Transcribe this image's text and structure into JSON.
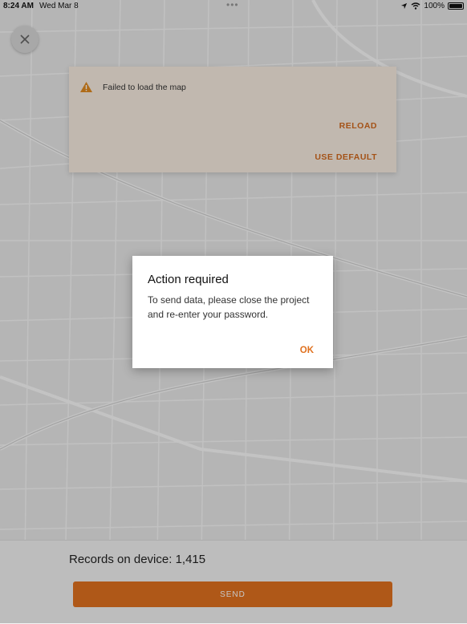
{
  "status_bar": {
    "time": "8:24 AM",
    "date": "Wed Mar 8",
    "dots": "•••",
    "battery": "100%"
  },
  "error_banner": {
    "message": "Failed to load the map",
    "reload_label": "RELOAD",
    "use_default_label": "USE DEFAULT"
  },
  "footer": {
    "records": "Records on device: 1,415",
    "send_label": "SEND"
  },
  "dialog": {
    "title": "Action required",
    "body": "To send data, please close the project and re-enter your password.",
    "ok_label": "OK"
  },
  "colors": {
    "accent": "#e0711f",
    "banner_bg": "#f8ece0",
    "map_bg": "#e9e9e9",
    "roads": "#f7f7f7"
  }
}
